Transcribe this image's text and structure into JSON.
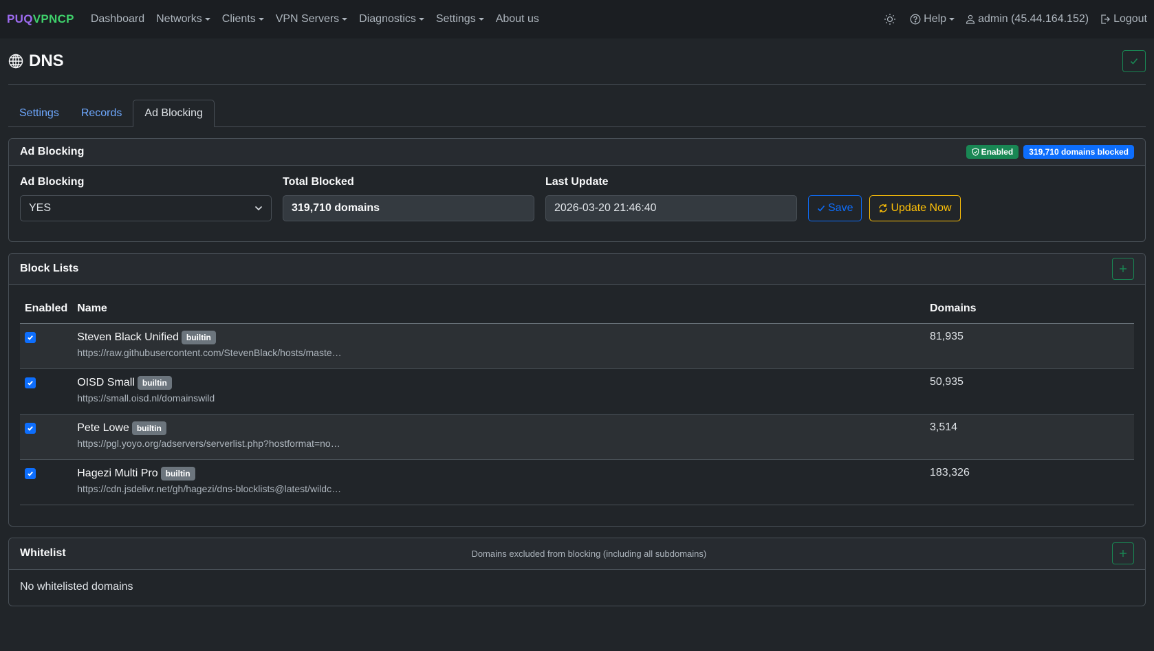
{
  "navbar": {
    "brand_part1": "PUQ",
    "brand_part2": "VPNCP",
    "items": [
      "Dashboard",
      "Networks",
      "Clients",
      "VPN Servers",
      "Diagnostics",
      "Settings",
      "About us"
    ],
    "theme_icon": "sun-icon",
    "help_label": "Help",
    "user_label": "admin (45.44.164.152)",
    "logout_label": "Logout"
  },
  "page": {
    "title": "DNS",
    "title_icon": "globe-icon"
  },
  "tabs": [
    {
      "label": "Settings",
      "active": false
    },
    {
      "label": "Records",
      "active": false
    },
    {
      "label": "Ad Blocking",
      "active": true
    }
  ],
  "ad_blocking": {
    "card_title": "Ad Blocking",
    "status_badge": "Enabled",
    "count_badge": "319,710 domains blocked",
    "fields": {
      "ad_blocking_label": "Ad Blocking",
      "ad_blocking_value": "YES",
      "total_blocked_label": "Total Blocked",
      "total_blocked_value": "319,710 domains",
      "last_update_label": "Last Update",
      "last_update_value": "2026-03-20 21:46:40"
    },
    "save_label": "Save",
    "update_label": "Update Now"
  },
  "block_lists": {
    "card_title": "Block Lists",
    "headers": {
      "enabled": "Enabled",
      "name": "Name",
      "domains": "Domains"
    },
    "rows": [
      {
        "name": "Steven Black Unified",
        "badge": "builtin",
        "url": "https://raw.githubusercontent.com/StevenBlack/hosts/maste…",
        "domains": "81,935",
        "enabled": true
      },
      {
        "name": "OISD Small",
        "badge": "builtin",
        "url": "https://small.oisd.nl/domainswild",
        "domains": "50,935",
        "enabled": true
      },
      {
        "name": "Pete Lowe",
        "badge": "builtin",
        "url": "https://pgl.yoyo.org/adservers/serverlist.php?hostformat=no…",
        "domains": "3,514",
        "enabled": true
      },
      {
        "name": "Hagezi Multi Pro",
        "badge": "builtin",
        "url": "https://cdn.jsdelivr.net/gh/hagezi/dns-blocklists@latest/wildc…",
        "domains": "183,326",
        "enabled": true
      }
    ]
  },
  "whitelist": {
    "card_title": "Whitelist",
    "subtitle": "Domains excluded from blocking (including all subdomains)",
    "empty_text": "No whitelisted domains"
  },
  "colors": {
    "accent_blue": "#0d6efd",
    "success_green": "#198754",
    "warning_yellow": "#ffc107",
    "brand_purple": "#9d6bf0",
    "brand_green": "#3fd06b"
  }
}
